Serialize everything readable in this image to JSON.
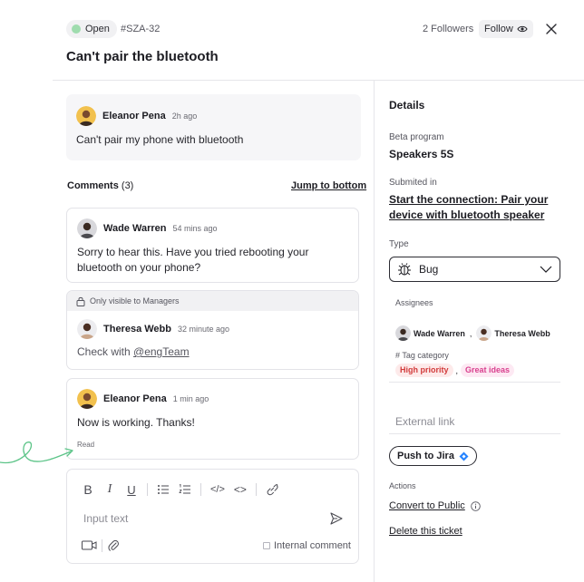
{
  "header": {
    "status": "Open",
    "ticket_id": "#SZA-32",
    "followers": "2 Followers",
    "follow_label": "Follow",
    "title": "Can't pair the bluetooth"
  },
  "first_post": {
    "author": "Eleanor Pena",
    "time": "2h ago",
    "body": "Can't pair my phone with bluetooth"
  },
  "comments": {
    "title": "Comments",
    "count": "(3)",
    "jump_label": "Jump to bottom",
    "items": [
      {
        "author": "Wade Warren",
        "time": "54 mins ago",
        "body": "Sorry to hear this. Have you tried rebooting your bluetooth on your phone?"
      },
      {
        "visibility": "Only visible to Managers",
        "author": "Theresa Webb",
        "time": "32 minute ago",
        "body_prefix": "Check with ",
        "mention": "@engTeam"
      },
      {
        "author": "Eleanor Pena",
        "time": "1 min ago",
        "body": "Now is working. Thanks!",
        "read": "Read"
      }
    ]
  },
  "editor": {
    "placeholder": "Input text",
    "internal_label": "Internal comment",
    "toolbar": [
      "bold-icon",
      "italic-icon",
      "underline-icon",
      "bullet-list-icon",
      "numbered-list-icon",
      "code-inline-icon",
      "code-block-icon",
      "link-icon"
    ],
    "bold_glyph": "B",
    "italic_glyph": "I",
    "underline_glyph": "U",
    "code_inline_glyph": "</>",
    "code_block_glyph": "<>"
  },
  "details": {
    "title": "Details",
    "beta_program_label": "Beta program",
    "beta_program_value": "Speakers 5S",
    "submitted_label": "Submited in",
    "submitted_value": "Start the connection: Pair your device with bluetooth speaker",
    "type_label": "Type",
    "type_value": "Bug",
    "assignees_label": "Assignees",
    "assignees": [
      "Wade Warren",
      "Theresa Webb"
    ],
    "assignee_separator": ",",
    "tag_category_label": "# Tag category",
    "tags": [
      "High priority",
      "Great ideas"
    ],
    "tag_separator": ",",
    "external_link_placeholder": "External link",
    "push_label": "Push to Jira",
    "actions_label": "Actions",
    "convert_label": "Convert to Public",
    "delete_label": "Delete this ticket"
  },
  "colors": {
    "status_dot": "#9fdcae",
    "tag_red": "#d23b3b",
    "tag_pink": "#d9418f",
    "swirl": "#5cc488",
    "jira_blue": "#2684ff"
  }
}
